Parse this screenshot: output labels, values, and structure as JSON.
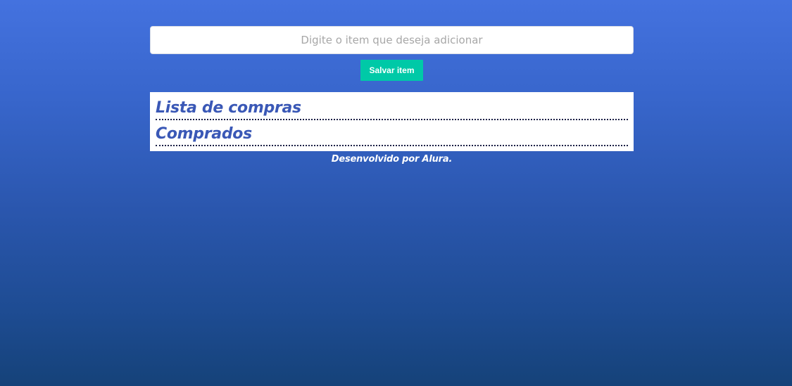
{
  "form": {
    "input_placeholder": "Digite o item que deseja adicionar",
    "input_value": "",
    "save_label": "Salvar item"
  },
  "lists": {
    "shopping_title": "Lista de compras",
    "purchased_title": "Comprados"
  },
  "footer": {
    "credit": "Desenvolvido por Alura."
  },
  "colors": {
    "background_top": "#4472df",
    "background_bottom": "#154279",
    "button": "#00c9a7",
    "heading": "#3a58b6",
    "divider": "#1b1f45"
  }
}
